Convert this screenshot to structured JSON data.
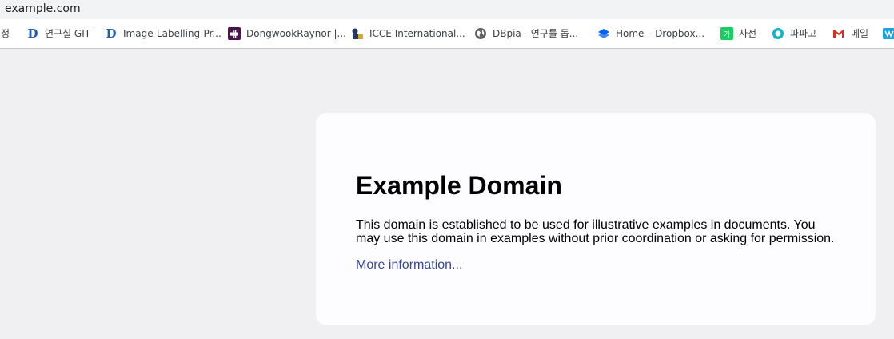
{
  "browser": {
    "url": "example.com",
    "bookmarks": [
      {
        "label": "설정",
        "icon": "folder-icon"
      },
      {
        "label": "연구실 GIT",
        "icon": "d-logo-icon"
      },
      {
        "label": "Image-Labelling-Pr...",
        "icon": "d-logo-icon"
      },
      {
        "label": "DongwookRaynor |...",
        "icon": "slack-icon"
      },
      {
        "label": "ICCE International...",
        "icon": "icce-icon"
      },
      {
        "label": "DBpia - 연구를 돕...",
        "icon": "globe-icon"
      },
      {
        "label": "Home – Dropbox...",
        "icon": "dropbox-icon"
      },
      {
        "label": "사전",
        "icon": "dictionary-icon"
      },
      {
        "label": "파파고",
        "icon": "papago-icon"
      },
      {
        "label": "메일",
        "icon": "gmail-icon"
      },
      {
        "label": "",
        "icon": "bookmark-icon"
      }
    ]
  },
  "page": {
    "title": "Example Domain",
    "body": "This domain is established to be used for illustrative examples in documents. You may use this domain in examples without prior coordination or asking for permission.",
    "link_text": "More information..."
  },
  "colors": {
    "page_background": "#f0f0f2",
    "card_background": "#fdfdff",
    "link": "#38488f"
  }
}
